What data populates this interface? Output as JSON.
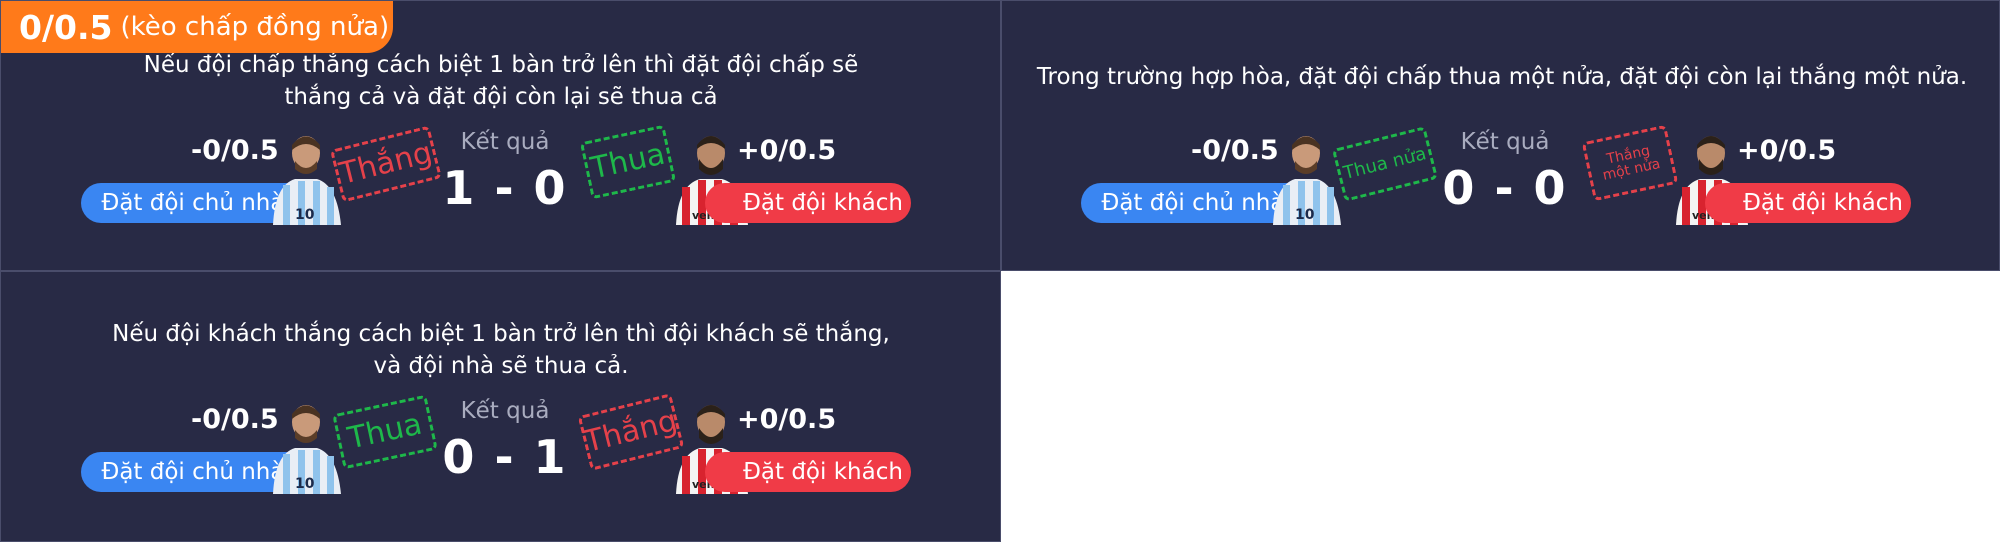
{
  "header": {
    "odds": "0/0.5",
    "subtitle": "(kèo chấp đồng nửa)"
  },
  "colors": {
    "panel_bg": "#282a45",
    "home": "#3a86f2",
    "away": "#f03b47",
    "win_stamp": "#e5414a",
    "lose_stamp": "#1eb84a",
    "tag": "#ff7a1a"
  },
  "panels": [
    {
      "desc_line1": "Nếu đội chấp thắng cách biệt 1 bàn trở lên thì đặt đội chấp sẽ",
      "desc_line2": "thắng cả và đặt đội còn lại sẽ thua cả",
      "home_odds": "-0/0.5",
      "away_odds": "+0/0.5",
      "home_label": "Đặt đội chủ nhà",
      "away_label": "Đặt đội khách",
      "result_label": "Kết quả",
      "score": "1 - 0",
      "home_stamp": "Thắng",
      "away_stamp": "Thua"
    },
    {
      "desc_line1": "Trong trường hợp hòa, đặt đội chấp thua một nửa, đặt đội còn lại thắng một nửa.",
      "home_odds": "-0/0.5",
      "away_odds": "+0/0.5",
      "home_label": "Đặt đội chủ nhà",
      "away_label": "Đặt đội khách",
      "result_label": "Kết quả",
      "score": "0 - 0",
      "home_stamp": "Thua nửa",
      "away_stamp": "Thắng một nửa"
    },
    {
      "desc_line1": "Nếu đội khách thắng cách biệt 1 bàn trở lên thì đội khách sẽ thắng,",
      "desc_line2": "và đội nhà sẽ thua cả.",
      "home_odds": "-0/0.5",
      "away_odds": "+0/0.5",
      "home_label": "Đặt đội chủ nhà",
      "away_label": "Đặt đội khách",
      "result_label": "Kết quả",
      "score": "0 - 1",
      "home_stamp": "Thua",
      "away_stamp": "Thắng"
    }
  ],
  "icons": {
    "home_player": "player-argentina-shirt-icon",
    "away_player": "player-red-white-stripes-icon"
  }
}
